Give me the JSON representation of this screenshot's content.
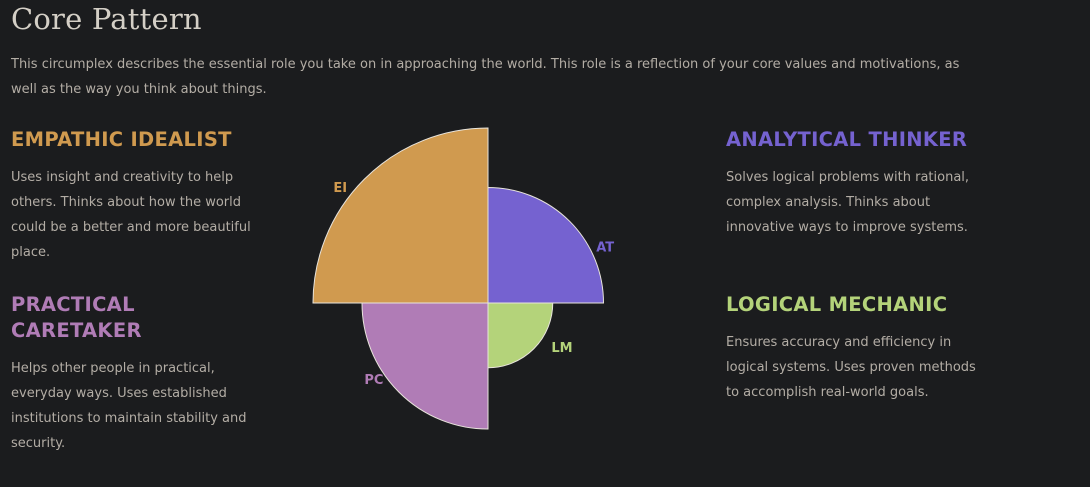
{
  "header": {
    "title": "Core Pattern",
    "intro": "This circumplex describes the essential role you take on in approaching the world. This role is a reflection of your core values and motivations, as well as the way you think about things."
  },
  "patterns": {
    "empathic_idealist": {
      "title": "EMPATHIC IDEALIST",
      "description": "Uses insight and creativity to help others. Thinks about how the world could be a better and more beautiful place.",
      "color": "#d09a4f"
    },
    "practical_caretaker": {
      "title": "PRACTICAL CARETAKER",
      "description": "Helps other people in practical, everyday ways. Uses established institutions to maintain stability and security.",
      "color": "#b07cb6"
    },
    "analytical_thinker": {
      "title": "ANALYTICAL THINKER",
      "description": "Solves logical problems with rational, complex analysis. Thinks about innovative ways to improve systems.",
      "color": "#7562d0"
    },
    "logical_mechanic": {
      "title": "LOGICAL MECHANIC",
      "description": "Ensures accuracy and efficiency in logical systems. Uses proven methods to accomplish real-world goals.",
      "color": "#b4d37a"
    }
  },
  "chart_data": {
    "type": "polar-area",
    "max": 100,
    "grid": false,
    "legend": "none",
    "slices": [
      {
        "label": "EI",
        "quadrant": "top-left",
        "value": 100,
        "color": "#d09a4f"
      },
      {
        "label": "AT",
        "quadrant": "top-right",
        "value": 66,
        "color": "#7562d0"
      },
      {
        "label": "LM",
        "quadrant": "bottom-right",
        "value": 37,
        "color": "#b4d37a"
      },
      {
        "label": "PC",
        "quadrant": "bottom-left",
        "value": 72,
        "color": "#b07cb6"
      }
    ]
  }
}
